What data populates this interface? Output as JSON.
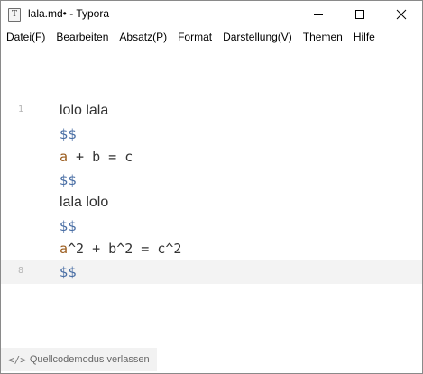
{
  "window": {
    "title": "lala.md• - Typora",
    "app_icon_glyph": "T"
  },
  "menu": {
    "items": [
      "Datei(F)",
      "Bearbeiten",
      "Absatz(P)",
      "Format",
      "Darstellung(V)",
      "Themen",
      "Hilfe"
    ]
  },
  "editor": {
    "first_line_number": "1",
    "active_line_number": "8",
    "lines": [
      {
        "type": "text",
        "text": "lolo lala"
      },
      {
        "type": "delim",
        "text": "$$"
      },
      {
        "type": "math",
        "var": "a",
        "rest": " + b = c"
      },
      {
        "type": "delim",
        "text": "$$"
      },
      {
        "type": "text",
        "text": "lala lolo"
      },
      {
        "type": "delim",
        "text": "$$"
      },
      {
        "type": "math",
        "var": "a",
        "rest": "^2 + b^2 = c^2"
      },
      {
        "type": "delim",
        "text": "$$"
      }
    ]
  },
  "statusbar": {
    "source_mode_icon": "</>",
    "source_mode_label": "Quellcodemodus verlassen"
  },
  "colors": {
    "math_delimiter": "#4a6fa5",
    "math_variable": "#9a5b1c",
    "text": "#333333",
    "active_line_bg": "#f3f3f3"
  }
}
